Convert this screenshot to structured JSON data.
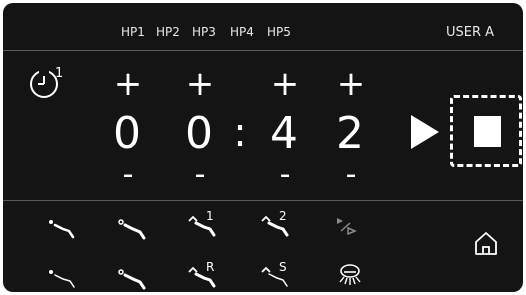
{
  "header": {
    "hp_labels": [
      "HP1",
      "HP2",
      "HP3",
      "HP4",
      "HP5"
    ],
    "user": "USER A"
  },
  "timer": {
    "index": "1",
    "digits": [
      "0",
      "0",
      "4",
      "2"
    ],
    "separator": ":",
    "plus": "+",
    "minus": "-"
  },
  "tools": {
    "row1": [
      {
        "icon": "handpiece-1-icon"
      },
      {
        "icon": "handpiece-2-icon"
      },
      {
        "icon": "handpiece-rotate-1-icon",
        "label": "1"
      },
      {
        "icon": "handpiece-rotate-2-icon",
        "label": "2"
      },
      {
        "icon": "play-step-icon"
      }
    ],
    "row2": [
      {
        "icon": "handpiece-3-icon"
      },
      {
        "icon": "handpiece-4-icon"
      },
      {
        "icon": "handpiece-reverse-icon",
        "label": "R"
      },
      {
        "icon": "handpiece-s-icon",
        "label": "S"
      },
      {
        "icon": "light-icon"
      }
    ]
  },
  "colors": {
    "panel": "#141414",
    "text": "#f2f2f2",
    "divider": "#5a5a5a"
  }
}
